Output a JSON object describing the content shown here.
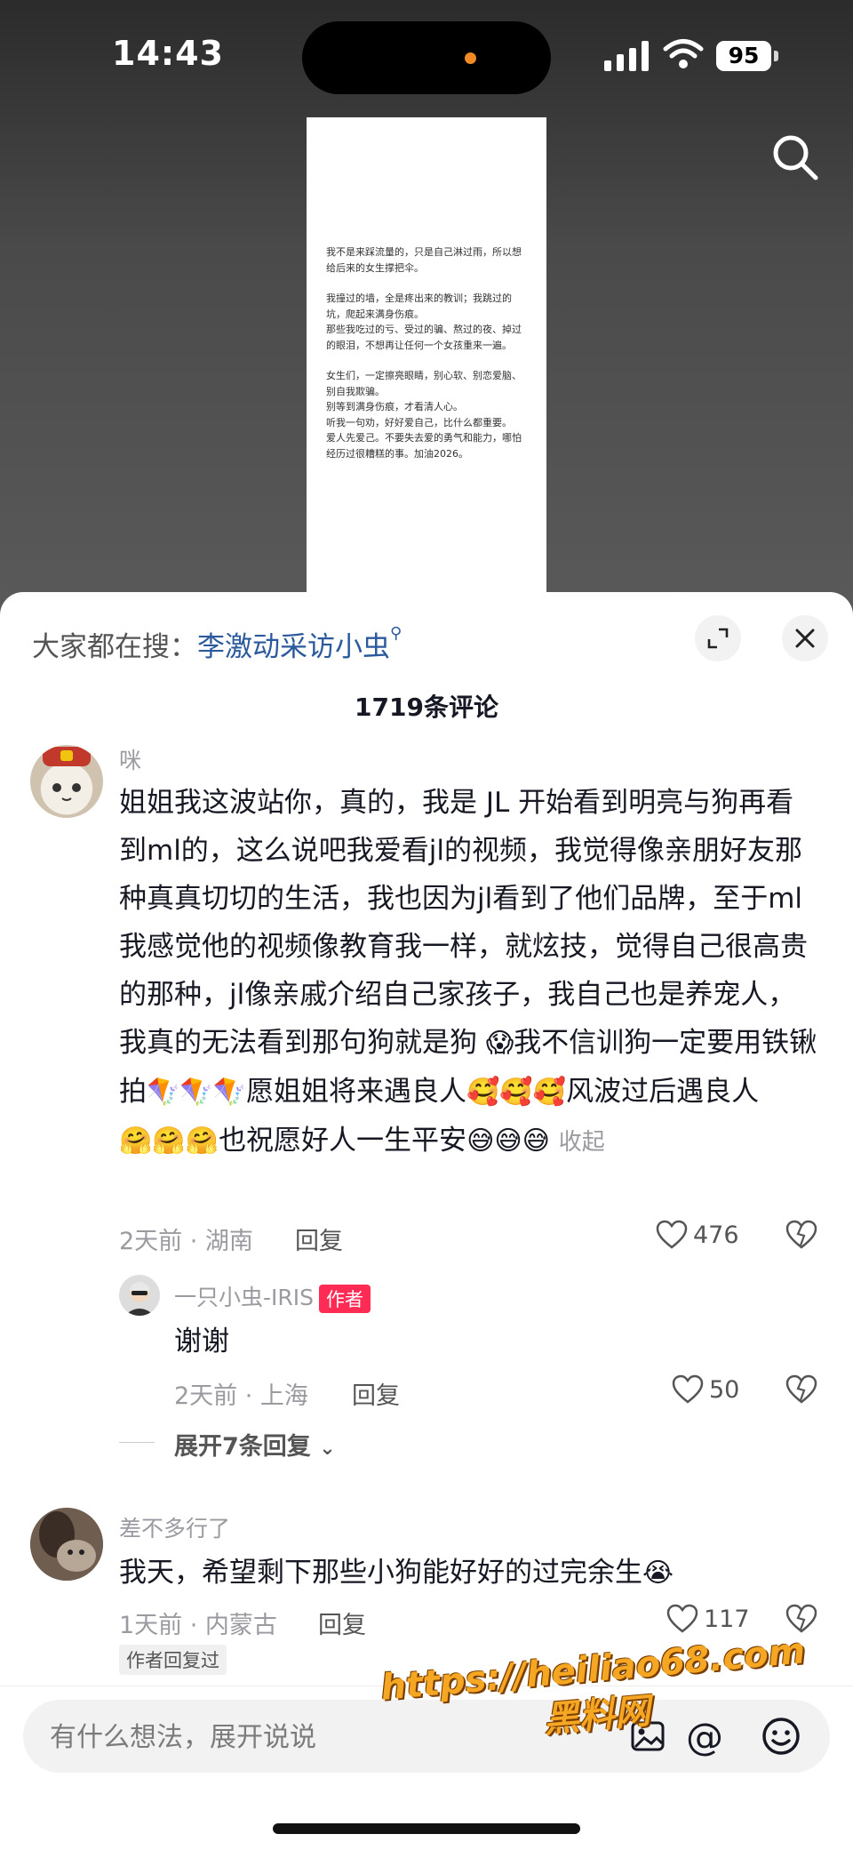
{
  "status": {
    "time": "14:43",
    "battery": "95"
  },
  "document": {
    "paragraphs": [
      "我不是来踩流量的，只是自己淋过雨，所以想给后来的女生撑把伞。",
      "我撞过的墙，全是疼出来的教训；我跳过的坑，爬起来满身伤痕。\n那些我吃过的亏、受过的骗、熬过的夜、掉过的眼泪，不想再让任何一个女孩重来一遍。",
      "女生们，一定擦亮眼睛，别心软、别恋爱脑、别自我欺骗。\n别等到满身伤痕，才看清人心。\n听我一句劝，好好爱自己，比什么都重要。\n爱人先爱己。不要失去爱的勇气和能力，哪怕经历过很糟糕的事。加油2026。"
    ]
  },
  "sheet": {
    "hot_prefix": "大家都在搜：",
    "hot_keyword": "李激动采访小虫",
    "comment_count": "1719条评论"
  },
  "comments": [
    {
      "user": "咪",
      "text": "姐姐我这波站你，真的，我是 JL 开始看到明亮与狗再看到ml的，这么说吧我爱看jl的视频，我觉得像亲朋好友那种真真切切的生活，我也因为jl看到了他们品牌，至于ml我感觉他的视频像教育我一样，就炫技，觉得自己很高贵的那种，jl像亲戚介绍自己家孩子，我自己也是养宠人，我真的无法看到那句狗就是狗",
      "text2": "我不信训狗一定要用铁锹拍",
      "text3": "愿姐姐将来遇良人",
      "text4": "风波过后遇良人",
      "text5": "也祝愿好人一生平安",
      "collapse": "收起",
      "meta": "2天前 · 湖南",
      "reply": "回复",
      "likes": "476"
    },
    {
      "user": "一只小虫-IRIS",
      "tag": "作者",
      "text": "谢谢",
      "meta": "2天前 · 上海",
      "reply": "回复",
      "likes": "50",
      "expand": "展开7条回复"
    },
    {
      "user": "差不多行了",
      "text": "我天，希望剩下那些小狗能好好的过完余生",
      "meta": "1天前 · 内蒙古",
      "reply": "回复",
      "likes": "117",
      "badge": "作者回复过"
    }
  ],
  "input": {
    "placeholder": "有什么想法，展开说说"
  },
  "watermark": {
    "line1": "https://heiliao68.com",
    "line2": "黑料网"
  }
}
